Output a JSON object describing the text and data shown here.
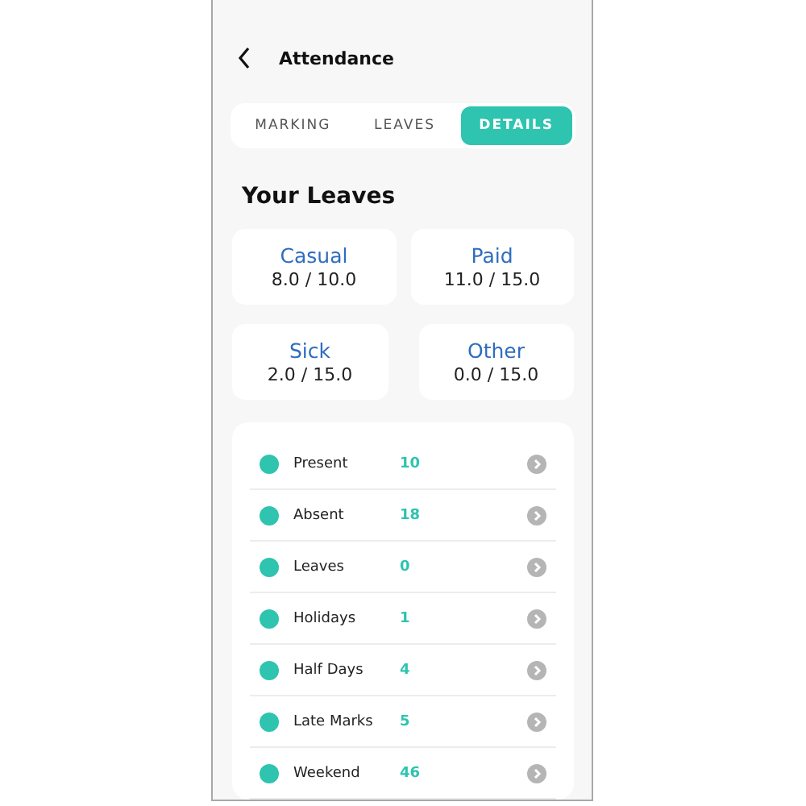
{
  "header": {
    "title": "Attendance"
  },
  "tabs": [
    {
      "label": "MARKING",
      "selected": false
    },
    {
      "label": "LEAVES",
      "selected": false
    },
    {
      "label": "DETAILS",
      "selected": true
    }
  ],
  "section_title": "Your Leaves",
  "leave_cards": [
    [
      {
        "type": "Casual",
        "balance": "8.0 / 10.0"
      },
      {
        "type": "Paid",
        "balance": "11.0 / 15.0"
      }
    ],
    [
      {
        "type": "Sick",
        "balance": "2.0 / 15.0"
      },
      {
        "type": "Other",
        "balance": "0.0 / 15.0"
      }
    ]
  ],
  "stats": [
    {
      "label": "Present",
      "count": "10"
    },
    {
      "label": "Absent",
      "count": "18"
    },
    {
      "label": "Leaves",
      "count": "0"
    },
    {
      "label": "Holidays",
      "count": "1"
    },
    {
      "label": "Half Days",
      "count": "4"
    },
    {
      "label": "Late Marks",
      "count": "5"
    },
    {
      "label": "Weekend",
      "count": "46"
    }
  ]
}
